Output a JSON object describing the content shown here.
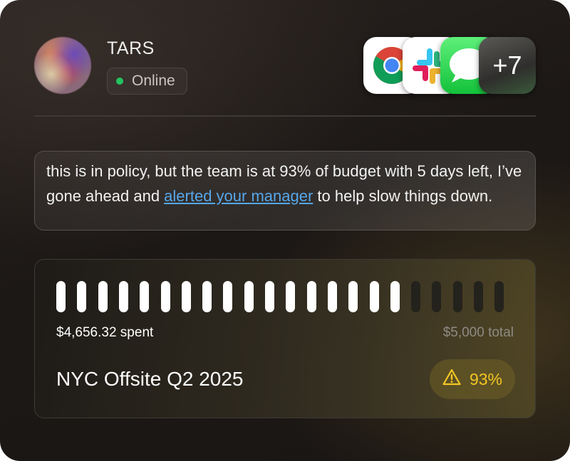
{
  "agent": {
    "name": "TARS",
    "status": "Online",
    "status_color": "#22c55e"
  },
  "apps": {
    "icons": [
      "chrome-icon",
      "slack-icon",
      "messages-icon"
    ],
    "more_label": "+7"
  },
  "message": {
    "text_before": "this is in policy, but the team is at 93% of budget with 5 days left, I’ve gone ahead and ",
    "link_text": "alerted your manager",
    "text_after": " to help slow things down."
  },
  "budget": {
    "spent_label": "$4,656.32 spent",
    "total_label": "$5,000 total",
    "project_name": "NYC Offsite Q2 2025",
    "percent_label": "93%",
    "bar_segments_total": 22,
    "bar_segments_filled": 17,
    "warning_color": "#f3c623"
  }
}
